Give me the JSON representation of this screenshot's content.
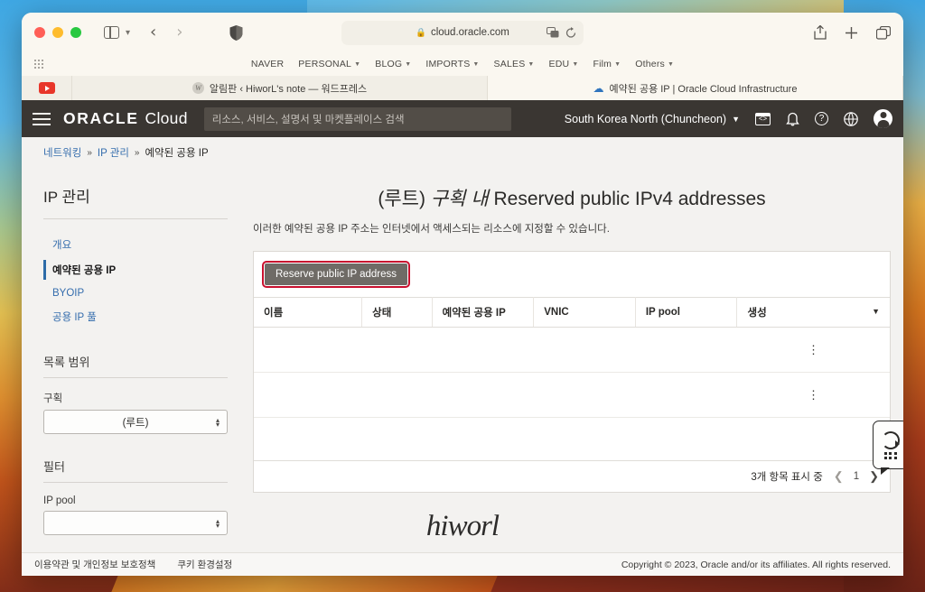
{
  "browser": {
    "window_controls": [
      "close",
      "minimize",
      "maximize"
    ],
    "url": "cloud.oracle.com",
    "lock_icon": "lock-icon",
    "reload_icon": "reload-icon",
    "translate_icon": "translate-icon",
    "shield_icon": "shield-icon",
    "back_icon": "back-arrow-icon",
    "forward_icon": "forward-arrow-icon",
    "sidebar_icon": "sidebar-toggle-icon",
    "share_icon": "share-icon",
    "newtab_icon": "plus-icon",
    "tabs_overview_icon": "tab-overview-icon",
    "bookmarks": [
      {
        "label": "NAVER",
        "has_chevron": false
      },
      {
        "label": "PERSONAL",
        "has_chevron": true
      },
      {
        "label": "BLOG",
        "has_chevron": true
      },
      {
        "label": "IMPORTS",
        "has_chevron": true
      },
      {
        "label": "SALES",
        "has_chevron": true
      },
      {
        "label": "EDU",
        "has_chevron": true
      },
      {
        "label": "Film",
        "has_chevron": true
      },
      {
        "label": "Others",
        "has_chevron": true
      }
    ],
    "tabs": [
      {
        "title": "알림판 ‹ HiworL's note — 워드프레스",
        "favicon": "wordpress-favicon",
        "active": false
      },
      {
        "title": "예약된 공용 IP | Oracle Cloud Infrastructure",
        "favicon": "oracle-cloud-favicon",
        "active": true
      }
    ],
    "youtube_tab_icon": "youtube-icon"
  },
  "occ_header": {
    "menu_icon": "hamburger-menu-icon",
    "logo_oracle": "ORACLE",
    "logo_cloud": "Cloud",
    "search_placeholder": "리소스, 서비스, 설명서 및 마켓플레이스 검색",
    "region": "South Korea North (Chuncheon)",
    "icons": [
      "cloud-shell-icon",
      "notifications-bell-icon",
      "help-question-icon",
      "language-globe-icon",
      "user-avatar-icon"
    ]
  },
  "breadcrumb": {
    "items": [
      "네트워킹",
      "IP 관리"
    ],
    "current": "예약된 공용 IP",
    "separator": "»"
  },
  "sidebar": {
    "title": "IP 관리",
    "items": [
      {
        "label": "개요",
        "active": false
      },
      {
        "label": "예약된 공용 IP",
        "active": true
      },
      {
        "label": "BYOIP",
        "active": false
      },
      {
        "label": "공용 IP 풀",
        "active": false
      }
    ],
    "list_scope": {
      "section_title": "목록 범위",
      "field_label": "구획",
      "value": "(루트)"
    },
    "filter": {
      "section_title": "필터",
      "field_label": "IP pool",
      "value": ""
    }
  },
  "main": {
    "heading_prefix": "(루트)",
    "heading_italic": "구획 내",
    "heading_suffix": "Reserved public IPv4 addresses",
    "description": "이러한 예약된 공용 IP 주소는 인터넷에서 액세스되는 리소스에 지정할 수 있습니다.",
    "primary_button": "Reserve public IP address",
    "primary_button_highlight": "#c8102e",
    "table": {
      "columns": [
        "이름",
        "상태",
        "예약된 공용 IP",
        "VNIC",
        "IP pool",
        "생성"
      ],
      "sort_caret": "caret-down-icon",
      "rows": [
        {
          "name": "",
          "state": "",
          "reserved_ip": "",
          "vnic": "",
          "ip_pool": "",
          "created": "",
          "menu": "kebab-menu-icon"
        },
        {
          "name": "",
          "state": "",
          "reserved_ip": "",
          "vnic": "",
          "ip_pool": "",
          "created": "",
          "menu": "kebab-menu-icon"
        }
      ]
    },
    "pagination": {
      "count_label": "3개 항목 표시 중",
      "prev_icon": "chevron-left-icon",
      "page": "1",
      "next_icon": "chevron-right-icon"
    }
  },
  "overlay_widget": {
    "name": "screen-recorder-widget",
    "icons": [
      "rotate-arrow-icon",
      "keypad-dots-icon"
    ]
  },
  "watermark": "hiworl",
  "footer": {
    "links": [
      "이용약관 및 개인정보 보호정책",
      "쿠키 환경설정"
    ],
    "copyright": "Copyright © 2023, Oracle and/or its affiliates. All rights reserved."
  }
}
